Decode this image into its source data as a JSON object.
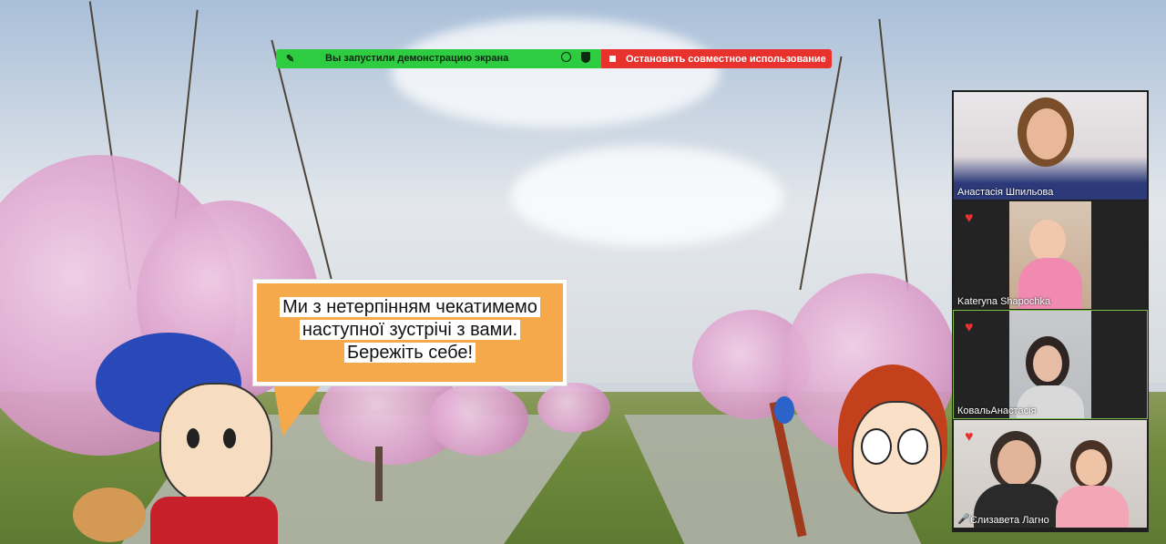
{
  "share_bar": {
    "status_text": "Вы запустили демонстрацию экрана",
    "stop_label": "Остановить совместное использование",
    "green": "#2ecc40",
    "red": "#e8322d"
  },
  "slide": {
    "speech_lines": [
      "Ми з нетерпінням чекатимемо",
      "наступної зустрічі з вами.",
      "Бережіть себе!"
    ],
    "bubble_color": "#f5a94a"
  },
  "participants": [
    {
      "name": "Анастасія Шпильова",
      "reaction": "",
      "mic_muted": false
    },
    {
      "name": "Kateryna Shapochka",
      "reaction": "heart",
      "mic_muted": false
    },
    {
      "name": "КовальАнастасія",
      "reaction": "heart",
      "mic_muted": false
    },
    {
      "name": "Єлизавета Лагно",
      "reaction": "heart",
      "mic_muted": true
    }
  ]
}
